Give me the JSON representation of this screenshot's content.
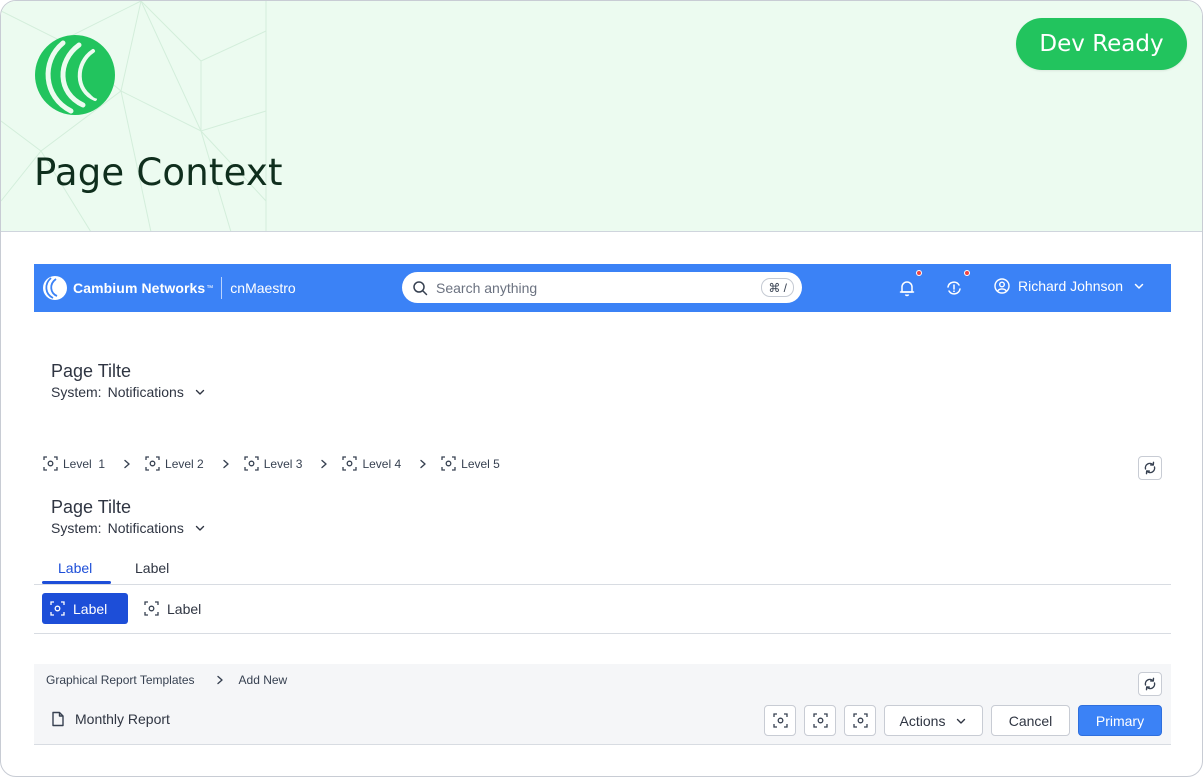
{
  "hero": {
    "title": "Page Context",
    "badge": "Dev Ready",
    "logo_icon": "cambium-logo-icon",
    "colors": {
      "background": "#ecfbf0",
      "badge": "#22c45e",
      "logo": "#22c45e"
    }
  },
  "topbar": {
    "brand": "Cambium Networks",
    "trademark": "™",
    "product": "cnMaestro",
    "search": {
      "placeholder": "Search anything",
      "shortcut": "⌘ /"
    },
    "icons": [
      "bell-icon",
      "sync-alert-icon",
      "user-circle-icon",
      "chevron-down-icon"
    ],
    "user_name": "Richard Johnson",
    "color": "#3b82f6"
  },
  "header_one": {
    "title": "Page Tilte",
    "system_label": "System:",
    "system_value": "Notifications"
  },
  "breadcrumb": {
    "items": [
      {
        "label": "Level  1"
      },
      {
        "label": "Level 2"
      },
      {
        "label": "Level 3"
      },
      {
        "label": "Level 4"
      },
      {
        "label": "Level 5"
      }
    ]
  },
  "header_two": {
    "title": "Page Tilte",
    "system_label": "System:",
    "system_value": "Notifications"
  },
  "tabs": [
    {
      "label": "Label",
      "active": true
    },
    {
      "label": "Label",
      "active": false
    }
  ],
  "segmented": [
    {
      "label": "Label",
      "active": true
    },
    {
      "label": "Label",
      "active": false
    }
  ],
  "report": {
    "breadcrumb": [
      "Graphical Report Templates",
      "Add New"
    ],
    "title": "Monthly Report",
    "actions_label": "Actions",
    "cancel_label": "Cancel",
    "primary_label": "Primary"
  }
}
